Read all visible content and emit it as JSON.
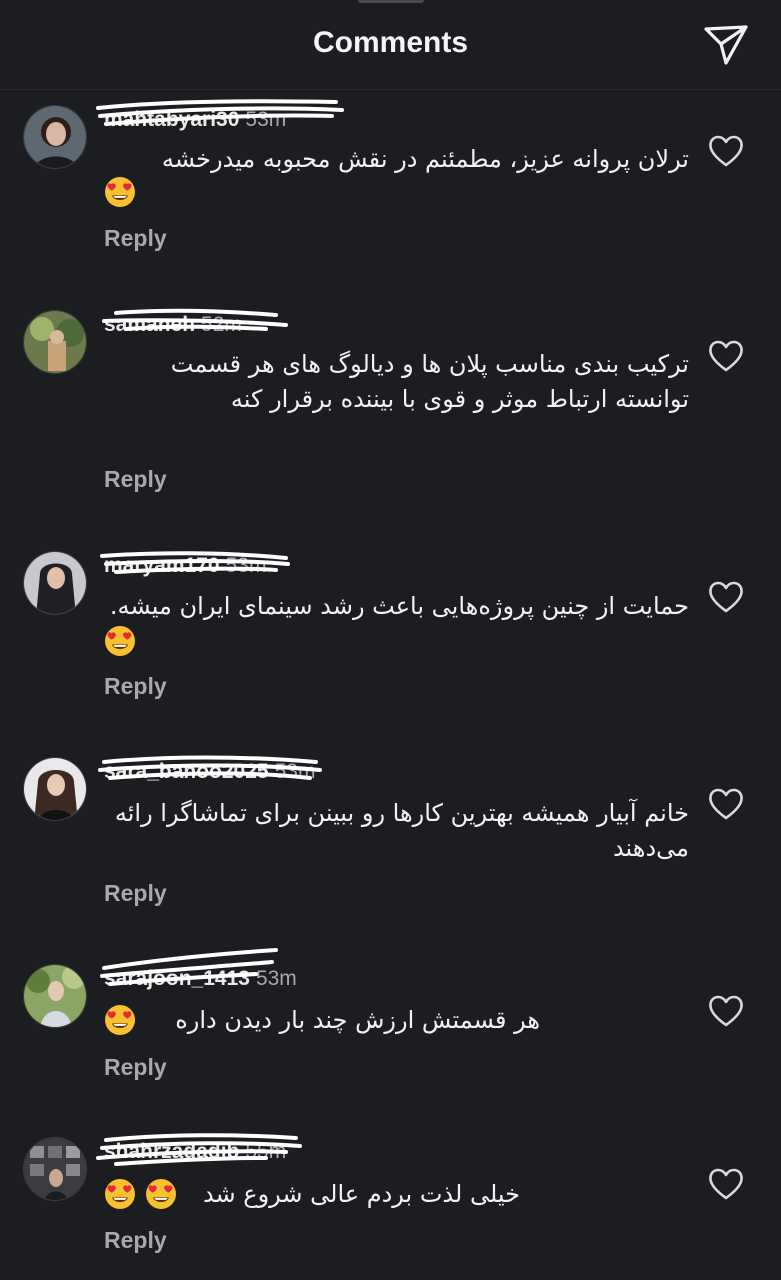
{
  "header": {
    "title": "Comments",
    "send_icon": "send-icon"
  },
  "comments": [
    {
      "username": "mahtabyari30",
      "time": "53m",
      "text": "ترلان پروانه عزیز، مطمئنم در نقش محبوبه میدرخشه",
      "emoji": "heart-eyes-emoji",
      "reply_label": "Reply"
    },
    {
      "username": "samaneh",
      "time": "52m",
      "text": "ترکیب بندی مناسب پلان ها و دیالوگ های هر قسمت توانسته ارتباط موثر و قوی با بیننده برقرار کنه",
      "reply_label": "Reply"
    },
    {
      "username": "maryam170",
      "time": "53m",
      "text": "حمایت از چنین پروژه‌هایی باعث رشد سینمای ایران میشه.",
      "emoji": "heart-eyes-emoji",
      "reply_label": "Reply"
    },
    {
      "username": "sara_banoo2025",
      "time": "53m",
      "text": "خانم آبیار همیشه بهترین کارها رو ببینن برای تماشاگرا رائه می‌دهند",
      "reply_label": "Reply"
    },
    {
      "username": "sarajoon_1413",
      "time": "53m",
      "text": "هر قسمتش ارزش چند بار دیدن داره",
      "emoji": "heart-eyes-emoji",
      "reply_label": "Reply"
    },
    {
      "username": "shahrzadadib",
      "time": "55m",
      "text": "خیلی لذت بردم عالی شروع شد",
      "emoji": "heart-eyes-emoji",
      "reply_label": "Reply"
    }
  ],
  "colors": {
    "background": "#1c1d21",
    "text": "#f2f2f2",
    "muted": "#a8a8ad",
    "scribble": "#ffffff"
  }
}
